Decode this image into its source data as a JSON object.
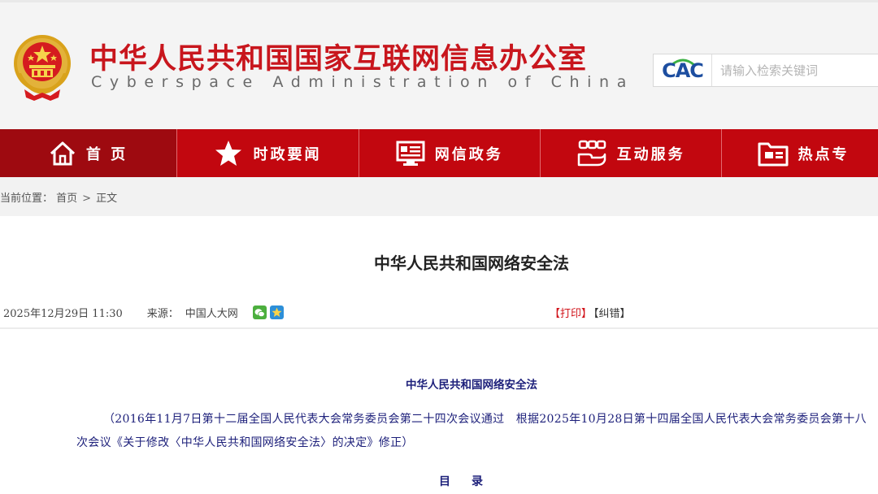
{
  "header": {
    "site_title": "中华人民共和国国家互联网信息办公室",
    "site_subtitle": "Cyberspace Administration of China",
    "logo_text": "CAC",
    "search_placeholder": "请输入检索关键词"
  },
  "nav": {
    "items": [
      {
        "label": "首 页",
        "icon": "home-icon"
      },
      {
        "label": "时政要闻",
        "icon": "star-icon"
      },
      {
        "label": "网信政务",
        "icon": "monitor-icon"
      },
      {
        "label": "互动服务",
        "icon": "service-icon"
      },
      {
        "label": "热点专",
        "icon": "folder-icon"
      }
    ]
  },
  "breadcrumb": {
    "prefix": "当前位置：",
    "home": "首页",
    "separator": ">",
    "current": "正文"
  },
  "article": {
    "title": "中华人民共和国网络安全法",
    "date": "2025年12月29日 11:30",
    "source_label": "来源：",
    "source": "中国人大网",
    "share_icons": [
      "wechat-icon",
      "qzone-icon"
    ],
    "print_label": "【打印】",
    "correct_label": "【纠错】",
    "body_title": "中华人民共和国网络安全法",
    "preface": "（2016年11月7日第十二届全国人民代表大会常务委员会第二十四次会议通过　根据2025年10月28日第十四届全国人民代表大会常务委员会第十八次会议《关于修改〈中华人民共和国网络安全法〉的决定》修正）",
    "toc_title": "目录"
  },
  "colors": {
    "brand_red": "#c2070f",
    "nav_active": "#9e0a10",
    "title_red": "#c8161d",
    "body_blue": "#1c1f7a",
    "logo_blue": "#1d4ea0"
  }
}
